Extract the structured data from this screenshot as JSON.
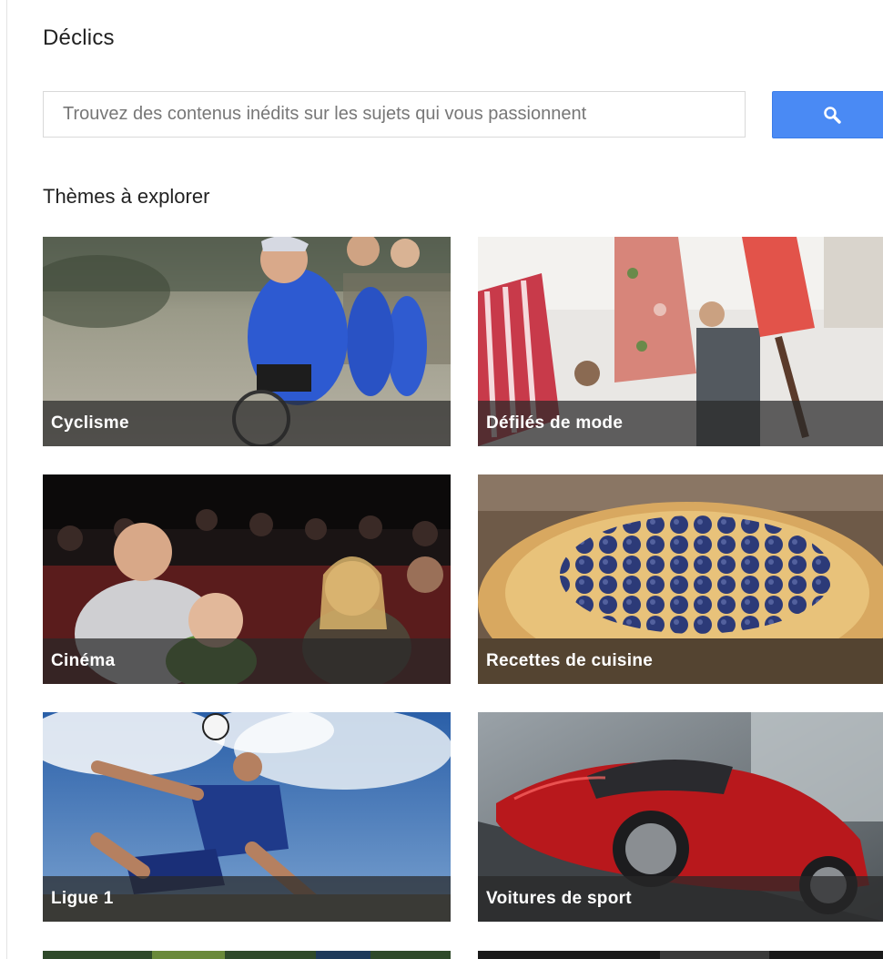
{
  "header": {
    "title": "Déclics"
  },
  "search": {
    "placeholder": "Trouvez des contenus inédits sur les sujets qui vous passionnent",
    "button_icon": "search-icon",
    "button_color": "#4a8af4"
  },
  "explore": {
    "title": "Thèmes à explorer",
    "topics": [
      {
        "label": "Cyclisme"
      },
      {
        "label": "Défilés de mode"
      },
      {
        "label": "Cinéma"
      },
      {
        "label": "Recettes de cuisine"
      },
      {
        "label": "Ligue 1"
      },
      {
        "label": "Voitures de sport"
      }
    ]
  }
}
